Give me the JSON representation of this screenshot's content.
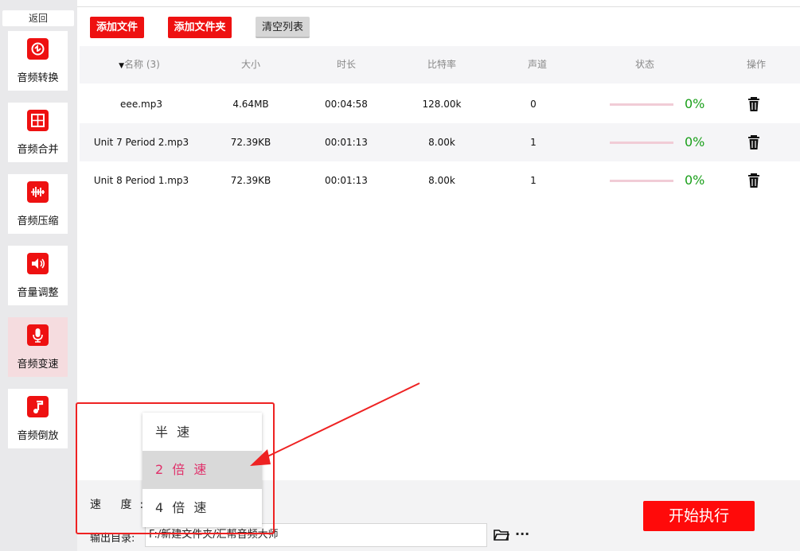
{
  "sidebar": {
    "back_label": "返回",
    "items": [
      {
        "label": "音频转换",
        "icon": "audio-convert-icon"
      },
      {
        "label": "音频合并",
        "icon": "audio-merge-icon"
      },
      {
        "label": "音频压缩",
        "icon": "audio-compress-icon"
      },
      {
        "label": "音量调整",
        "icon": "volume-icon"
      },
      {
        "label": "音频变速",
        "icon": "microphone-icon"
      },
      {
        "label": "音频倒放",
        "icon": "music-note-icon"
      }
    ],
    "active_index": 4
  },
  "toolbar": {
    "add_file": "添加文件",
    "add_folder": "添加文件夹",
    "clear_list": "清空列表"
  },
  "table": {
    "headers": {
      "name": "名称 (3)",
      "size": "大小",
      "duration": "时长",
      "bitrate": "比特率",
      "channels": "声道",
      "status": "状态",
      "action": "操作"
    },
    "rows": [
      {
        "name": "eee.mp3",
        "size": "4.64MB",
        "duration": "00:04:58",
        "bitrate": "128.00k",
        "channels": "0",
        "progress": "0%"
      },
      {
        "name": "Unit 7 Period 2.mp3",
        "size": "72.39KB",
        "duration": "00:01:13",
        "bitrate": "8.00k",
        "channels": "1",
        "progress": "0%"
      },
      {
        "name": "Unit 8 Period 1.mp3",
        "size": "72.39KB",
        "duration": "00:01:13",
        "bitrate": "8.00k",
        "channels": "1",
        "progress": "0%"
      }
    ]
  },
  "bottom": {
    "speed_label": "速 度:",
    "output_label": "输出目录:",
    "output_path": "F:/新建文件夹/汇帮音频大师",
    "more_label": "···",
    "start_label": "开始执行"
  },
  "speed_options": [
    "半 速",
    "2 倍 速",
    "4 倍 速"
  ],
  "speed_selected_index": 1,
  "colors": {
    "accent": "#ee1111",
    "progress_text": "#1a9f1a",
    "highlight_text": "#e0306a"
  }
}
